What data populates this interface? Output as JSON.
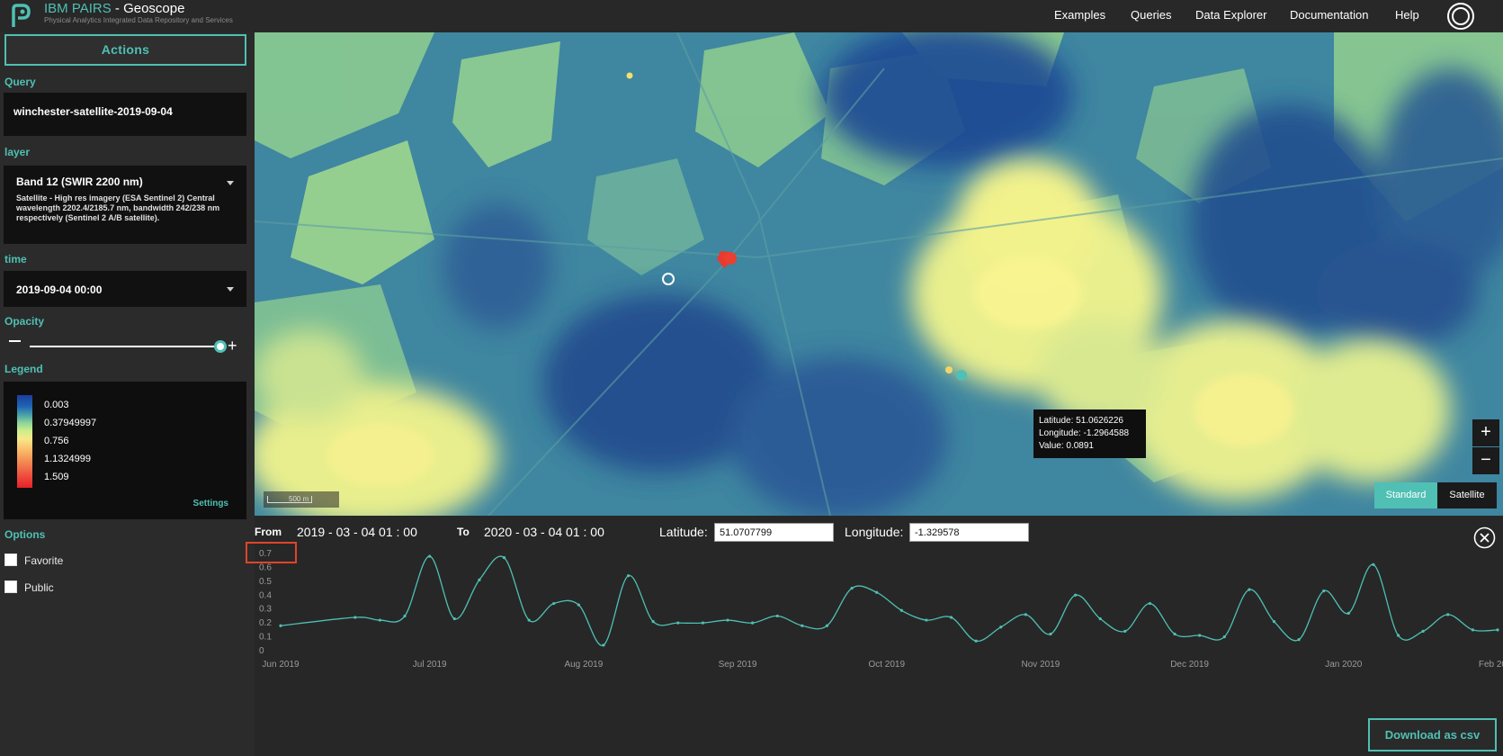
{
  "header": {
    "brand_prefix": "IBM PAIRS",
    "brand_suffix": " - Geoscope",
    "subtitle": "Physical Analytics Integrated Data Repository and Services",
    "nav": [
      "Examples",
      "Queries",
      "Data Explorer",
      "Documentation",
      "Help"
    ]
  },
  "sidebar": {
    "actions_label": "Actions",
    "query_label": "Query",
    "query_value": "winchester-satellite-2019-09-04",
    "layer_label": "layer",
    "layer_value": "Band 12 (SWIR 2200 nm)",
    "layer_description": "Satellite - High res imagery (ESA Sentinel 2) Central wavelength 2202.4/2185.7 nm, bandwidth 242/238 nm respectively (Sentinel 2 A/B satellite).",
    "time_label": "time",
    "time_value": "2019-09-04 00:00",
    "opacity_label": "Opacity",
    "opacity": 0.95,
    "legend_label": "Legend",
    "legend_values": [
      "0.003",
      "0.37949997",
      "0.756",
      "1.1324999",
      "1.509"
    ],
    "legend_settings": "Settings",
    "options_label": "Options",
    "options": [
      {
        "label": "Favorite",
        "checked": false
      },
      {
        "label": "Public",
        "checked": false
      }
    ]
  },
  "map": {
    "tooltip": {
      "latitude": "Latitude: 51.0626226",
      "longitude": "Longitude: -1.2964588",
      "value": "Value: 0.0891"
    },
    "zoom_in": "+",
    "zoom_out": "−",
    "basemap_standard": "Standard",
    "basemap_satellite": "Satellite",
    "scale_label": "500 m"
  },
  "timeseries": {
    "from_label": "From",
    "from_value": "2019 - 03 - 04   01 : 00",
    "to_label": "To",
    "to_value": "2020 - 03 - 04   01 : 00",
    "latitude_label": "Latitude:",
    "latitude_value": "51.0707799",
    "longitude_label": "Longitude:",
    "longitude_value": "-1.329578",
    "download_label": "Download as csv"
  },
  "chart_data": {
    "type": "line",
    "title": "",
    "xlabel": "",
    "ylabel": "",
    "ylim": [
      0,
      0.7
    ],
    "y_ticks": [
      "0",
      "0.1",
      "0.2",
      "0.3",
      "0.4",
      "0.5",
      "0.6",
      "0.7"
    ],
    "x_ticks": [
      "Jun 2019",
      "Jul 2019",
      "Aug 2019",
      "Sep 2019",
      "Oct 2019",
      "Nov 2019",
      "Dec 2019",
      "Jan 2020",
      "Feb 2020"
    ],
    "x_domain": [
      "2019-06-01",
      "2020-02-01"
    ],
    "line_color": "#4fc0b3",
    "series": [
      {
        "x": [
          "2019-06-01",
          "2019-06-16",
          "2019-06-21",
          "2019-06-26",
          "2019-07-01",
          "2019-07-06",
          "2019-07-11",
          "2019-07-16",
          "2019-07-21",
          "2019-07-26",
          "2019-07-31",
          "2019-08-05",
          "2019-08-10",
          "2019-08-15",
          "2019-08-20",
          "2019-08-25",
          "2019-08-30",
          "2019-09-04",
          "2019-09-09",
          "2019-09-14",
          "2019-09-19",
          "2019-09-24",
          "2019-09-29",
          "2019-10-04",
          "2019-10-09",
          "2019-10-14",
          "2019-10-19",
          "2019-10-24",
          "2019-10-29",
          "2019-11-03",
          "2019-11-08",
          "2019-11-13",
          "2019-11-18",
          "2019-11-23",
          "2019-11-28",
          "2019-12-03",
          "2019-12-08",
          "2019-12-13",
          "2019-12-18",
          "2019-12-23",
          "2019-12-28",
          "2020-01-02",
          "2020-01-07",
          "2020-01-12",
          "2020-01-17",
          "2020-01-22",
          "2020-01-27",
          "2020-02-01"
        ],
        "y": [
          0.18,
          0.24,
          0.22,
          0.25,
          0.68,
          0.23,
          0.51,
          0.67,
          0.22,
          0.34,
          0.33,
          0.04,
          0.54,
          0.21,
          0.2,
          0.2,
          0.22,
          0.2,
          0.25,
          0.18,
          0.18,
          0.45,
          0.42,
          0.29,
          0.22,
          0.24,
          0.07,
          0.17,
          0.26,
          0.12,
          0.4,
          0.23,
          0.14,
          0.34,
          0.12,
          0.11,
          0.1,
          0.44,
          0.21,
          0.08,
          0.43,
          0.27,
          0.62,
          0.11,
          0.14,
          0.26,
          0.15,
          0.15
        ]
      }
    ]
  }
}
